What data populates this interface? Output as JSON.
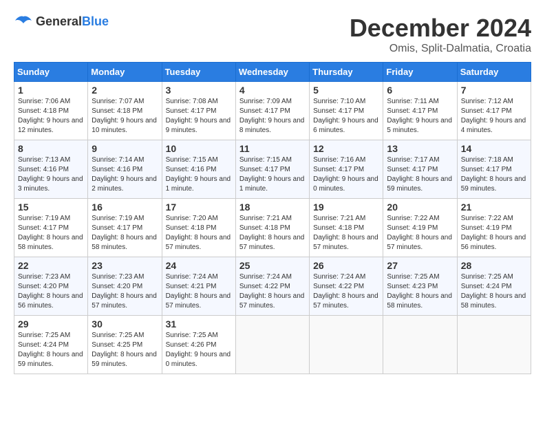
{
  "header": {
    "logo_general": "General",
    "logo_blue": "Blue",
    "month": "December 2024",
    "location": "Omis, Split-Dalmatia, Croatia"
  },
  "weekdays": [
    "Sunday",
    "Monday",
    "Tuesday",
    "Wednesday",
    "Thursday",
    "Friday",
    "Saturday"
  ],
  "weeks": [
    [
      {
        "day": "1",
        "sunrise": "Sunrise: 7:06 AM",
        "sunset": "Sunset: 4:18 PM",
        "daylight": "Daylight: 9 hours and 12 minutes."
      },
      {
        "day": "2",
        "sunrise": "Sunrise: 7:07 AM",
        "sunset": "Sunset: 4:18 PM",
        "daylight": "Daylight: 9 hours and 10 minutes."
      },
      {
        "day": "3",
        "sunrise": "Sunrise: 7:08 AM",
        "sunset": "Sunset: 4:17 PM",
        "daylight": "Daylight: 9 hours and 9 minutes."
      },
      {
        "day": "4",
        "sunrise": "Sunrise: 7:09 AM",
        "sunset": "Sunset: 4:17 PM",
        "daylight": "Daylight: 9 hours and 8 minutes."
      },
      {
        "day": "5",
        "sunrise": "Sunrise: 7:10 AM",
        "sunset": "Sunset: 4:17 PM",
        "daylight": "Daylight: 9 hours and 6 minutes."
      },
      {
        "day": "6",
        "sunrise": "Sunrise: 7:11 AM",
        "sunset": "Sunset: 4:17 PM",
        "daylight": "Daylight: 9 hours and 5 minutes."
      },
      {
        "day": "7",
        "sunrise": "Sunrise: 7:12 AM",
        "sunset": "Sunset: 4:17 PM",
        "daylight": "Daylight: 9 hours and 4 minutes."
      }
    ],
    [
      {
        "day": "8",
        "sunrise": "Sunrise: 7:13 AM",
        "sunset": "Sunset: 4:16 PM",
        "daylight": "Daylight: 9 hours and 3 minutes."
      },
      {
        "day": "9",
        "sunrise": "Sunrise: 7:14 AM",
        "sunset": "Sunset: 4:16 PM",
        "daylight": "Daylight: 9 hours and 2 minutes."
      },
      {
        "day": "10",
        "sunrise": "Sunrise: 7:15 AM",
        "sunset": "Sunset: 4:16 PM",
        "daylight": "Daylight: 9 hours and 1 minute."
      },
      {
        "day": "11",
        "sunrise": "Sunrise: 7:15 AM",
        "sunset": "Sunset: 4:17 PM",
        "daylight": "Daylight: 9 hours and 1 minute."
      },
      {
        "day": "12",
        "sunrise": "Sunrise: 7:16 AM",
        "sunset": "Sunset: 4:17 PM",
        "daylight": "Daylight: 9 hours and 0 minutes."
      },
      {
        "day": "13",
        "sunrise": "Sunrise: 7:17 AM",
        "sunset": "Sunset: 4:17 PM",
        "daylight": "Daylight: 8 hours and 59 minutes."
      },
      {
        "day": "14",
        "sunrise": "Sunrise: 7:18 AM",
        "sunset": "Sunset: 4:17 PM",
        "daylight": "Daylight: 8 hours and 59 minutes."
      }
    ],
    [
      {
        "day": "15",
        "sunrise": "Sunrise: 7:19 AM",
        "sunset": "Sunset: 4:17 PM",
        "daylight": "Daylight: 8 hours and 58 minutes."
      },
      {
        "day": "16",
        "sunrise": "Sunrise: 7:19 AM",
        "sunset": "Sunset: 4:17 PM",
        "daylight": "Daylight: 8 hours and 58 minutes."
      },
      {
        "day": "17",
        "sunrise": "Sunrise: 7:20 AM",
        "sunset": "Sunset: 4:18 PM",
        "daylight": "Daylight: 8 hours and 57 minutes."
      },
      {
        "day": "18",
        "sunrise": "Sunrise: 7:21 AM",
        "sunset": "Sunset: 4:18 PM",
        "daylight": "Daylight: 8 hours and 57 minutes."
      },
      {
        "day": "19",
        "sunrise": "Sunrise: 7:21 AM",
        "sunset": "Sunset: 4:18 PM",
        "daylight": "Daylight: 8 hours and 57 minutes."
      },
      {
        "day": "20",
        "sunrise": "Sunrise: 7:22 AM",
        "sunset": "Sunset: 4:19 PM",
        "daylight": "Daylight: 8 hours and 57 minutes."
      },
      {
        "day": "21",
        "sunrise": "Sunrise: 7:22 AM",
        "sunset": "Sunset: 4:19 PM",
        "daylight": "Daylight: 8 hours and 56 minutes."
      }
    ],
    [
      {
        "day": "22",
        "sunrise": "Sunrise: 7:23 AM",
        "sunset": "Sunset: 4:20 PM",
        "daylight": "Daylight: 8 hours and 56 minutes."
      },
      {
        "day": "23",
        "sunrise": "Sunrise: 7:23 AM",
        "sunset": "Sunset: 4:20 PM",
        "daylight": "Daylight: 8 hours and 57 minutes."
      },
      {
        "day": "24",
        "sunrise": "Sunrise: 7:24 AM",
        "sunset": "Sunset: 4:21 PM",
        "daylight": "Daylight: 8 hours and 57 minutes."
      },
      {
        "day": "25",
        "sunrise": "Sunrise: 7:24 AM",
        "sunset": "Sunset: 4:22 PM",
        "daylight": "Daylight: 8 hours and 57 minutes."
      },
      {
        "day": "26",
        "sunrise": "Sunrise: 7:24 AM",
        "sunset": "Sunset: 4:22 PM",
        "daylight": "Daylight: 8 hours and 57 minutes."
      },
      {
        "day": "27",
        "sunrise": "Sunrise: 7:25 AM",
        "sunset": "Sunset: 4:23 PM",
        "daylight": "Daylight: 8 hours and 58 minutes."
      },
      {
        "day": "28",
        "sunrise": "Sunrise: 7:25 AM",
        "sunset": "Sunset: 4:24 PM",
        "daylight": "Daylight: 8 hours and 58 minutes."
      }
    ],
    [
      {
        "day": "29",
        "sunrise": "Sunrise: 7:25 AM",
        "sunset": "Sunset: 4:24 PM",
        "daylight": "Daylight: 8 hours and 59 minutes."
      },
      {
        "day": "30",
        "sunrise": "Sunrise: 7:25 AM",
        "sunset": "Sunset: 4:25 PM",
        "daylight": "Daylight: 8 hours and 59 minutes."
      },
      {
        "day": "31",
        "sunrise": "Sunrise: 7:25 AM",
        "sunset": "Sunset: 4:26 PM",
        "daylight": "Daylight: 9 hours and 0 minutes."
      },
      null,
      null,
      null,
      null
    ]
  ]
}
